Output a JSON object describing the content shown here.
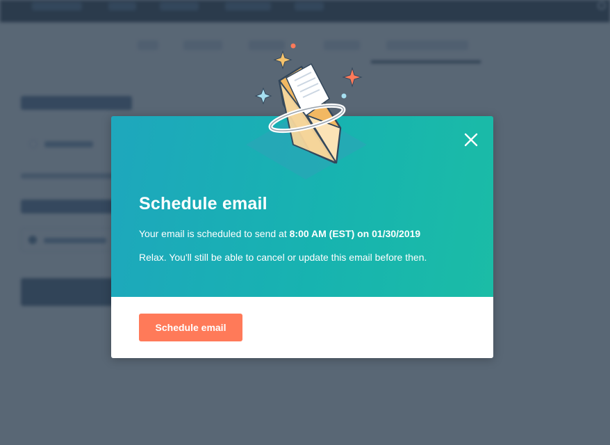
{
  "background": {
    "note": ""
  },
  "modal": {
    "title": "Schedule email",
    "line1_prefix": "Your email is scheduled to send at ",
    "line1_time": "8:00 AM (EST)",
    "line1_middle": " on ",
    "line1_date": "01/30/2019",
    "line2": "Relax. You'll still be able to cancel or update this email before then.",
    "primary_button_label": "Schedule email",
    "close_icon": "close-icon"
  },
  "colors": {
    "accent": "#ff7a59",
    "header_gradient_start": "#1ea7bd",
    "header_gradient_end": "#1bbca6",
    "overlay": "#2d3e50",
    "nav": "#253342"
  },
  "icons": {
    "illustration": "envelope-illustration",
    "sparkles": "sparkle-icon"
  }
}
